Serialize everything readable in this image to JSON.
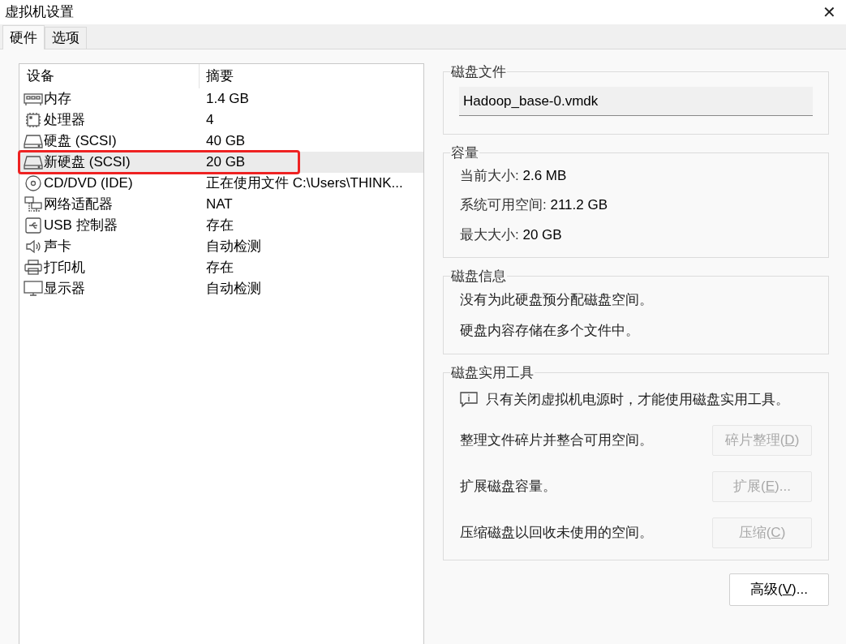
{
  "window": {
    "title": "虚拟机设置",
    "close": "✕"
  },
  "tabs": [
    {
      "label": "硬件",
      "selected": true
    },
    {
      "label": "选项",
      "selected": false
    }
  ],
  "device_list": {
    "columns": [
      "设备",
      "摘要"
    ],
    "rows": [
      {
        "kind": "memory",
        "device": "内存",
        "summary": "1.4 GB",
        "selected": false,
        "highlighted": false
      },
      {
        "kind": "cpu",
        "device": "处理器",
        "summary": "4",
        "selected": false,
        "highlighted": false
      },
      {
        "kind": "disk",
        "device": "硬盘 (SCSI)",
        "summary": "40 GB",
        "selected": false,
        "highlighted": false
      },
      {
        "kind": "disk",
        "device": "新硬盘 (SCSI)",
        "summary": "20 GB",
        "selected": true,
        "highlighted": true
      },
      {
        "kind": "cdrom",
        "device": "CD/DVD (IDE)",
        "summary": "正在使用文件 C:\\Users\\THINK...",
        "selected": false,
        "highlighted": false
      },
      {
        "kind": "network",
        "device": "网络适配器",
        "summary": "NAT",
        "selected": false,
        "highlighted": false
      },
      {
        "kind": "usb",
        "device": "USB 控制器",
        "summary": "存在",
        "selected": false,
        "highlighted": false
      },
      {
        "kind": "sound",
        "device": "声卡",
        "summary": "自动检测",
        "selected": false,
        "highlighted": false
      },
      {
        "kind": "printer",
        "device": "打印机",
        "summary": "存在",
        "selected": false,
        "highlighted": false
      },
      {
        "kind": "display",
        "device": "显示器",
        "summary": "自动检测",
        "selected": false,
        "highlighted": false
      }
    ]
  },
  "disk_file": {
    "title": "磁盘文件",
    "value": "Hadoop_base-0.vmdk"
  },
  "capacity": {
    "title": "容量",
    "lines": [
      {
        "label": "当前大小:",
        "value": "2.6 MB"
      },
      {
        "label": "系统可用空间:",
        "value": "211.2 GB"
      },
      {
        "label": "最大大小:",
        "value": "20 GB"
      }
    ]
  },
  "disk_info": {
    "title": "磁盘信息",
    "lines": [
      "没有为此硬盘预分配磁盘空间。",
      "硬盘内容存储在多个文件中。"
    ]
  },
  "disk_utilities": {
    "title": "磁盘实用工具",
    "notice": "只有关闭虚拟机电源时，才能使用磁盘实用工具。",
    "actions": [
      {
        "description": "整理文件碎片并整合可用空间。",
        "button": {
          "before": "碎片整理(",
          "key": "D",
          "after": ")",
          "disabled": true
        }
      },
      {
        "description": "扩展磁盘容量。",
        "button": {
          "before": "扩展(",
          "key": "E",
          "after": ")...",
          "disabled": true
        }
      },
      {
        "description": "压缩磁盘以回收未使用的空间。",
        "button": {
          "before": "压缩(",
          "key": "C",
          "after": ")",
          "disabled": true
        }
      }
    ]
  },
  "advanced_button": {
    "before": "高级(",
    "key": "V",
    "after": ")...",
    "disabled": false
  }
}
